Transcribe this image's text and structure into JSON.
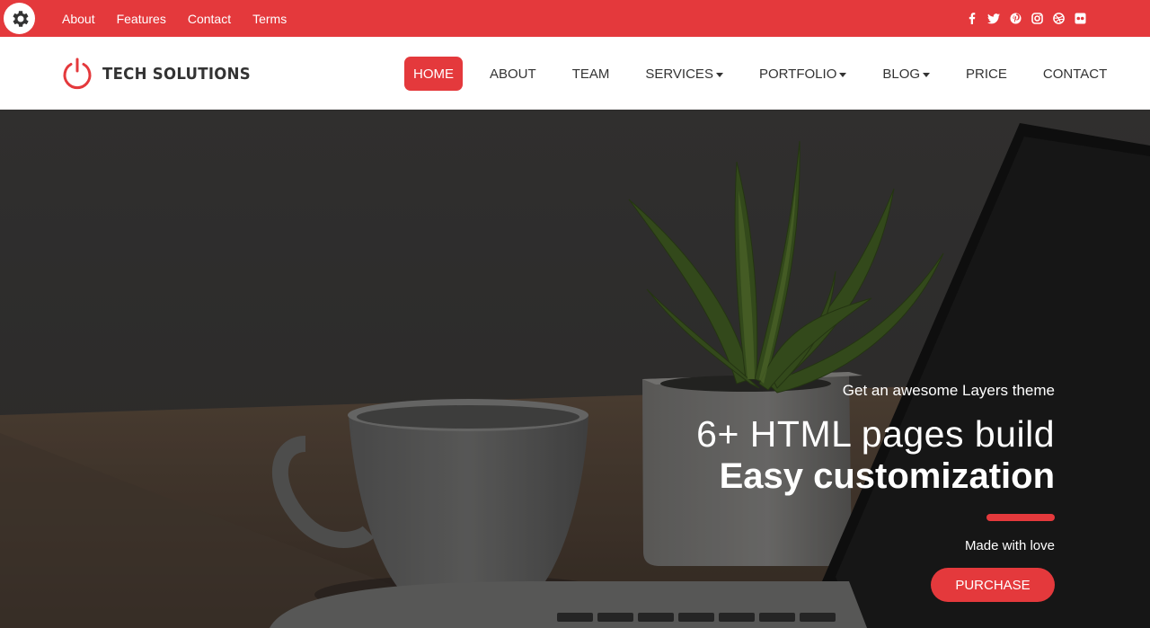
{
  "topbar": {
    "links": [
      "About",
      "Features",
      "Contact",
      "Terms"
    ],
    "social_icons": [
      "facebook-icon",
      "twitter-icon",
      "pinterest-icon",
      "instagram-icon",
      "dribbble-icon",
      "flickr-icon"
    ],
    "color": "#e4393c"
  },
  "header": {
    "logo_text": "TECH SOLUTIONS",
    "logo_icon": "power-icon",
    "nav": [
      {
        "label": "HOME",
        "active": true
      },
      {
        "label": "ABOUT"
      },
      {
        "label": "TEAM"
      },
      {
        "label": "SERVICES",
        "dropdown": true
      },
      {
        "label": "PORTFOLIO",
        "dropdown": true
      },
      {
        "label": "BLOG",
        "dropdown": true
      },
      {
        "label": "PRICE"
      },
      {
        "label": "CONTACT"
      }
    ]
  },
  "hero": {
    "tagline": "Get an awesome Layers theme",
    "headline1": "6+ HTML pages build",
    "headline2": "Easy customization",
    "subtext": "Made with love",
    "button": "PURCHASE"
  }
}
